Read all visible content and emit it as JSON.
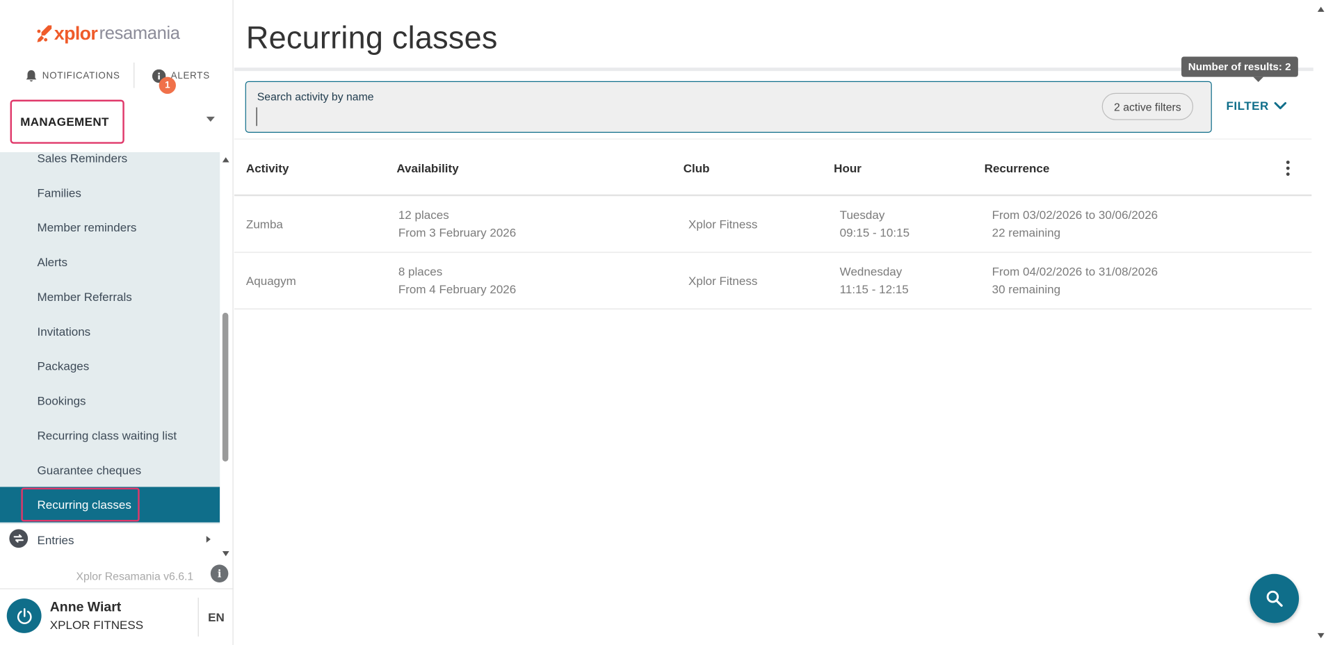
{
  "brand": {
    "part1": "xplor",
    "part2": "resamania",
    "accent": "#ef5b2a",
    "primary": "#0f6e8a"
  },
  "top_links": {
    "notifications": "NOTIFICATIONS",
    "alerts": "ALERTS",
    "alerts_badge": "1"
  },
  "section": {
    "label": "MANAGEMENT"
  },
  "menu": {
    "items": [
      {
        "label": "Sales Reminders"
      },
      {
        "label": "Families"
      },
      {
        "label": "Member reminders"
      },
      {
        "label": "Alerts"
      },
      {
        "label": "Member Referrals"
      },
      {
        "label": "Invitations"
      },
      {
        "label": "Packages"
      },
      {
        "label": "Bookings"
      },
      {
        "label": "Recurring class waiting list"
      },
      {
        "label": "Guarantee cheques"
      }
    ],
    "active": "Recurring classes",
    "entries": "Entries"
  },
  "version": "Xplor Resamania v6.6.1",
  "user": {
    "name": "Anne Wiart",
    "club": "XPLOR FITNESS",
    "lang": "EN"
  },
  "page": {
    "title": "Recurring classes"
  },
  "search": {
    "label": "Search activity by name",
    "value": "",
    "placeholder": "",
    "filters_chip": "2 active filters"
  },
  "filter_button": "FILTER",
  "tooltip": "Number of results: 2",
  "table": {
    "columns": [
      "Activity",
      "Availability",
      "Club",
      "Hour",
      "Recurrence"
    ],
    "rows": [
      {
        "activity": "Zumba",
        "places": "12 places",
        "from": "From 3 February 2026",
        "club": "Xplor Fitness",
        "day": "Tuesday",
        "hours": "09:15 - 10:15",
        "range": "From 03/02/2026 to 30/06/2026",
        "remaining": "22 remaining"
      },
      {
        "activity": "Aquagym",
        "places": "8 places",
        "from": "From 4 February 2026",
        "club": "Xplor Fitness",
        "day": "Wednesday",
        "hours": "11:15 - 12:15",
        "range": "From 04/02/2026 to 31/08/2026",
        "remaining": "30 remaining"
      }
    ]
  },
  "icons": [
    "bell-icon",
    "info-icon",
    "caret-down-icon",
    "exchange-icon",
    "power-icon",
    "chevron-down-icon",
    "more-vert-icon",
    "search-icon"
  ]
}
